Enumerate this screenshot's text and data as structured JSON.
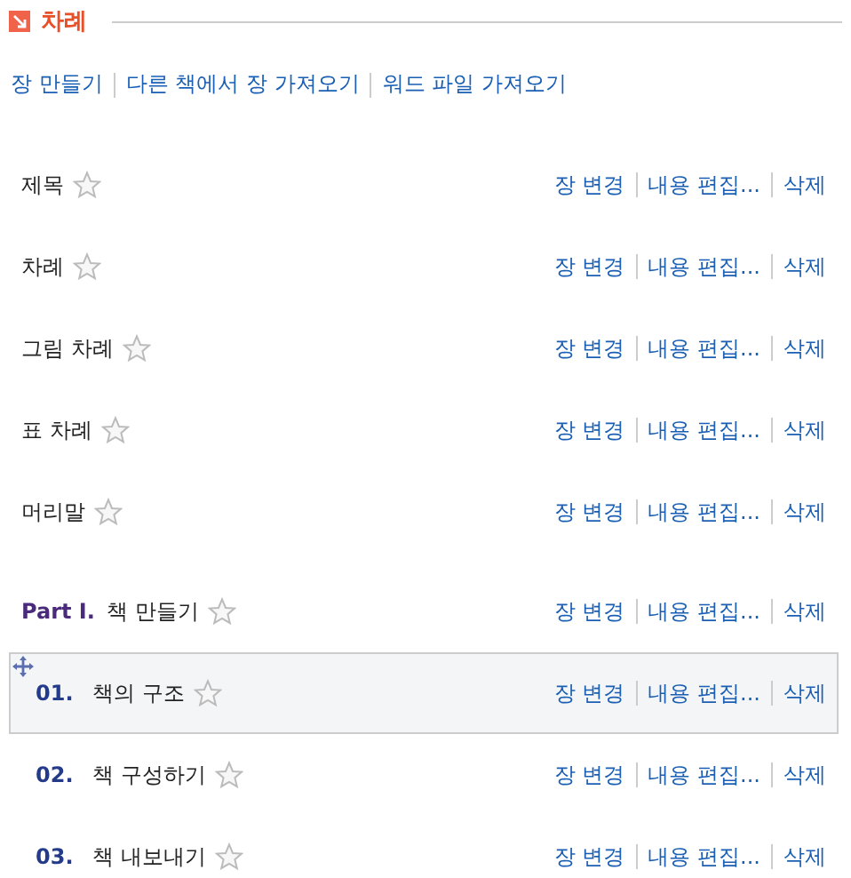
{
  "section": {
    "title": "차례"
  },
  "toolbar": [
    "장 만들기",
    "다른 책에서 장 가져오기",
    "워드 파일 가져오기"
  ],
  "rows": [
    {
      "kind": "front",
      "title": "제목",
      "highlighted": false,
      "actions": [
        "장 변경",
        "내용 편집...",
        "삭제"
      ]
    },
    {
      "kind": "front",
      "title": "차례",
      "highlighted": false,
      "actions": [
        "장 변경",
        "내용 편집...",
        "삭제"
      ]
    },
    {
      "kind": "front",
      "title": "그림 차례",
      "highlighted": false,
      "actions": [
        "장 변경",
        "내용 편집...",
        "삭제"
      ]
    },
    {
      "kind": "front",
      "title": "표 차례",
      "highlighted": false,
      "actions": [
        "장 변경",
        "내용 편집...",
        "삭제"
      ]
    },
    {
      "kind": "front",
      "title": "머리말",
      "highlighted": false,
      "actions": [
        "장 변경",
        "내용 편집...",
        "삭제"
      ]
    },
    {
      "kind": "part",
      "number": "Part I.",
      "title": "책 만들기",
      "highlighted": false,
      "actions": [
        "장 변경",
        "내용 편집...",
        "삭제"
      ]
    },
    {
      "kind": "chapter",
      "number": "01.",
      "title": "책의 구조",
      "highlighted": true,
      "actions": [
        "장 변경",
        "내용 편집...",
        "삭제"
      ]
    },
    {
      "kind": "chapter",
      "number": "02.",
      "title": "책 구성하기",
      "highlighted": false,
      "actions": [
        "장 변경",
        "내용 편집...",
        "삭제"
      ]
    },
    {
      "kind": "chapter",
      "number": "03.",
      "title": "책 내보내기",
      "highlighted": false,
      "actions": [
        "장 변경",
        "내용 편집...",
        "삭제"
      ]
    }
  ]
}
